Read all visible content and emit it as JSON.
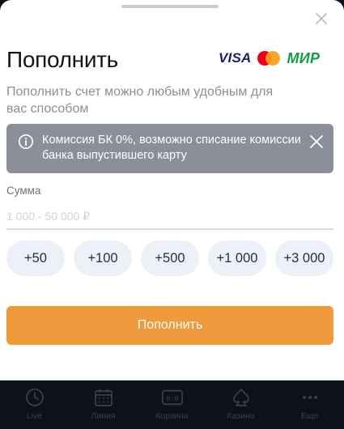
{
  "sheet": {
    "title": "Пополнить",
    "subtitle": "Пополнить счет можно любым удобным для вас способом",
    "payment_logos": {
      "visa": "VISA",
      "mir": "МИР"
    }
  },
  "notice": {
    "text": "Комиссия БК 0%, возможно списание комиссии банка выпустившего карту"
  },
  "amount": {
    "label": "Сумма",
    "placeholder": "1 000 - 50 000 ₽",
    "value": ""
  },
  "quick_amounts": [
    "+50",
    "+100",
    "+500",
    "+1 000",
    "+3 000"
  ],
  "submit_label": "Пополнить",
  "tabbar": {
    "items": [
      {
        "label": "Live",
        "icon": "clock-icon"
      },
      {
        "label": "Линия",
        "icon": "calendar-icon"
      },
      {
        "label": "Корзина",
        "icon": "scoreboard-icon"
      },
      {
        "label": "Казино",
        "icon": "spade-icon"
      },
      {
        "label": "Еще",
        "icon": "more-dots-icon"
      }
    ]
  },
  "colors": {
    "accent": "#f09a3e",
    "notice_bg": "#8a8f99",
    "chip_bg": "#ecf1f7",
    "tabbar_bg": "#0c111a"
  }
}
